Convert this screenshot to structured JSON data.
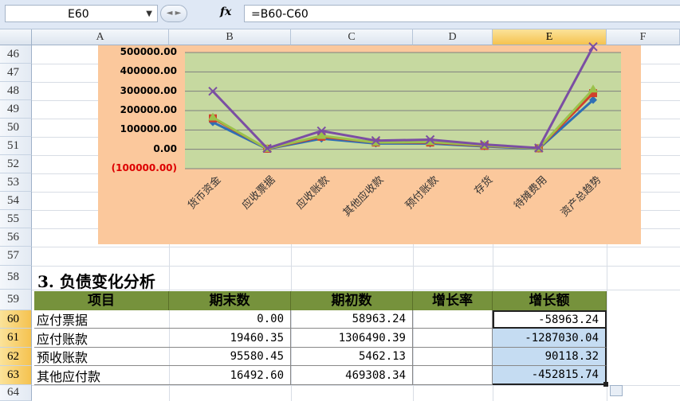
{
  "formula_bar": {
    "name_box": "E60",
    "fx": "fx",
    "formula": "=B60-C60"
  },
  "columns": [
    "A",
    "B",
    "C",
    "D",
    "E",
    "F"
  ],
  "rows": [
    "46",
    "47",
    "48",
    "49",
    "50",
    "51",
    "52",
    "53",
    "54",
    "55",
    "56",
    "57",
    "58",
    "59",
    "60",
    "61",
    "62",
    "63",
    "64"
  ],
  "chart_data": {
    "type": "line",
    "categories": [
      "货币资金",
      "应收票据",
      "应收账款",
      "其他应收款",
      "预付账款",
      "存货",
      "待摊费用",
      "资产总趋势"
    ],
    "y_ticks": [
      "500000.00",
      "400000.00",
      "300000.00",
      "200000.00",
      "100000.00",
      "0.00",
      "(100000.00)"
    ],
    "ylim": [
      -100000,
      500000
    ],
    "series": [
      {
        "values": [
          140000,
          2000,
          55000,
          30000,
          30000,
          15000,
          3000,
          255000
        ]
      },
      {
        "values": [
          160000,
          3000,
          65000,
          35000,
          35000,
          18000,
          5000,
          290000
        ]
      },
      {
        "values": [
          165000,
          3000,
          70000,
          35000,
          38000,
          20000,
          5000,
          310000
        ]
      },
      {
        "values": [
          300000,
          5000,
          95000,
          45000,
          50000,
          25000,
          7000,
          530000
        ]
      }
    ],
    "colors": [
      "#2f6fb5",
      "#d13f2c",
      "#9bc24b",
      "#7b4ea3"
    ],
    "grid": true
  },
  "section_title": "3. 负债变化分析",
  "table": {
    "headers": [
      "项目",
      "期末数",
      "期初数",
      "增长率",
      "增长额"
    ],
    "rows": [
      {
        "item": "应付票据",
        "end": "0.00",
        "start": "58963.24",
        "rate": "",
        "delta": "-58963.24"
      },
      {
        "item": "应付账款",
        "end": "19460.35",
        "start": "1306490.39",
        "rate": "",
        "delta": "-1287030.04"
      },
      {
        "item": "预收账款",
        "end": "95580.45",
        "start": "5462.13",
        "rate": "",
        "delta": "90118.32"
      },
      {
        "item": "其他应付款",
        "end": "16492.60",
        "start": "469308.34",
        "rate": "",
        "delta": "-452815.74"
      }
    ]
  }
}
